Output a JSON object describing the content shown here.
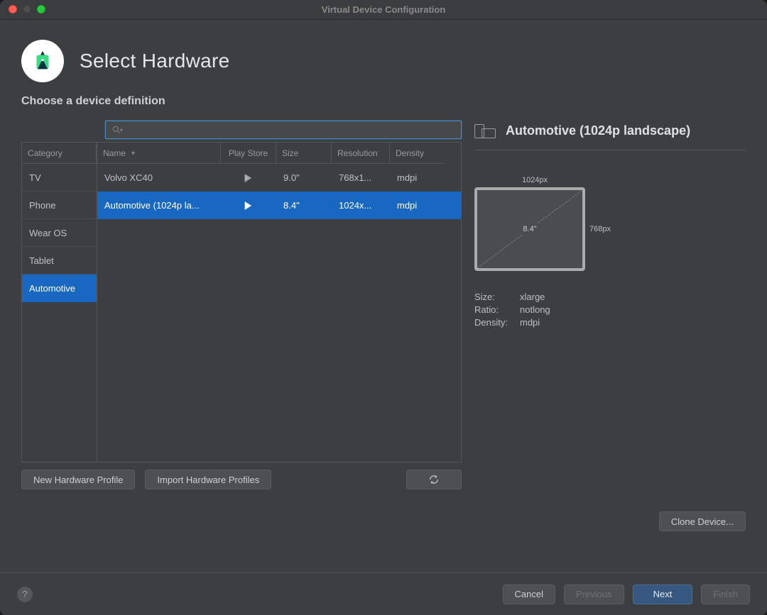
{
  "window": {
    "title": "Virtual Device Configuration"
  },
  "header": {
    "title": "Select Hardware"
  },
  "subheader": "Choose a device definition",
  "search": {
    "placeholder": ""
  },
  "category": {
    "header": "Category",
    "items": [
      "TV",
      "Phone",
      "Wear OS",
      "Tablet",
      "Automotive"
    ],
    "selected_index": 4
  },
  "table": {
    "headers": {
      "name": "Name",
      "play_store": "Play Store",
      "size": "Size",
      "resolution": "Resolution",
      "density": "Density"
    },
    "rows": [
      {
        "name": "Volvo XC40",
        "play_store": true,
        "size": "9.0\"",
        "resolution": "768x1...",
        "density": "mdpi"
      },
      {
        "name": "Automotive (1024p la...",
        "play_store": true,
        "size": "8.4\"",
        "resolution": "1024x...",
        "density": "mdpi"
      }
    ],
    "selected_index": 1
  },
  "left_actions": {
    "new": "New Hardware Profile",
    "import": "Import Hardware Profiles"
  },
  "right": {
    "title": "Automotive (1024p landscape)",
    "width_px": "1024px",
    "height_px": "768px",
    "diag": "8.4\"",
    "props": {
      "size_key": "Size:",
      "size_val": "xlarge",
      "ratio_key": "Ratio:",
      "ratio_val": "notlong",
      "density_key": "Density:",
      "density_val": "mdpi"
    },
    "clone": "Clone Device..."
  },
  "footer": {
    "cancel": "Cancel",
    "previous": "Previous",
    "next": "Next",
    "finish": "Finish"
  }
}
